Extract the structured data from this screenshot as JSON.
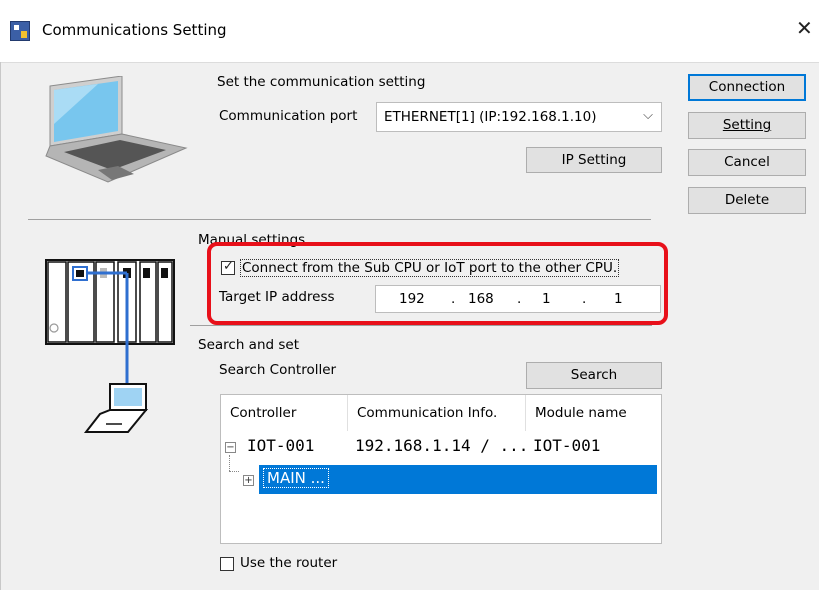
{
  "window": {
    "title": "Communications Setting",
    "close_glyph": "✕"
  },
  "comm": {
    "heading": "Set the communication setting",
    "port_label": "Communication port",
    "port_value": "ETHERNET[1]  (IP:192.168.1.10)",
    "ip_setting_button": "IP Setting"
  },
  "buttons": {
    "connection": "Connection",
    "setting": "Setting",
    "cancel": "Cancel",
    "delete": "Delete"
  },
  "manual": {
    "heading": "Manual settings",
    "checkbox_label": "Connect from the Sub CPU or IoT port to the other CPU.",
    "checkbox_checked": true,
    "target_ip_label": "Target IP address",
    "ip": [
      "192",
      "168",
      "1",
      "1"
    ]
  },
  "search": {
    "heading": "Search and set",
    "controller_label": "Search Controller",
    "search_button": "Search"
  },
  "table": {
    "columns": [
      "Controller",
      "Communication Info.",
      "Module name"
    ],
    "rows": [
      {
        "controller": "IOT-001",
        "info": "192.168.1.14 / ...",
        "module": "IOT-001",
        "expander": "−"
      },
      {
        "controller": "MAIN ...",
        "info": "",
        "module": "",
        "expander": "+",
        "selected": true
      }
    ]
  },
  "router": {
    "label": "Use the router",
    "checked": false
  },
  "colors": {
    "accent": "#0078d7",
    "highlight": "#e8101a",
    "selection": "#0078d7"
  },
  "icons": [
    "app-icon",
    "laptop-icon",
    "plc-icon",
    "network-laptop-icon",
    "close-icon"
  ]
}
